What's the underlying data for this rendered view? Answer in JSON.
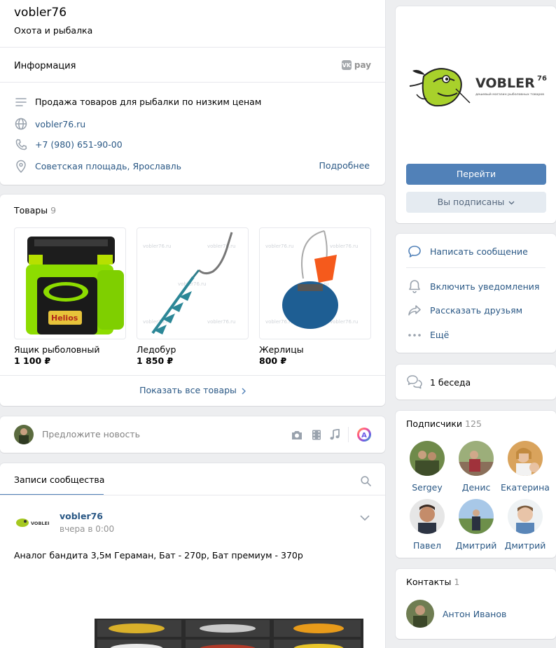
{
  "header": {
    "name": "vobler76",
    "status": "Охота и рыбалка"
  },
  "info": {
    "title": "Информация",
    "vkpay": "pay",
    "description": "Продажа товаров для рыбалки по низким ценам",
    "site": "vobler76.ru",
    "phone": "+7 (980) 651-90-00",
    "address": "Советская площадь, Ярославль",
    "more": "Подробнее"
  },
  "goods": {
    "title": "Товары",
    "count": "9",
    "watermark": "vobler76.ru",
    "items": [
      {
        "name": "Ящик рыболовный",
        "price": "1 100 ₽"
      },
      {
        "name": "Ледобур",
        "price": "1 850 ₽"
      },
      {
        "name": "Жерлицы",
        "price": "800 ₽"
      }
    ],
    "show_all": "Показать все товары"
  },
  "suggest": {
    "placeholder": "Предложите новость"
  },
  "wall": {
    "tab": "Записи сообщества",
    "post": {
      "author": "vobler76",
      "time": "вчера в 0:00",
      "text": "Аналог бандита 3,5м Гераман, Бат - 270р, Бат премиум - 370р"
    }
  },
  "cover": {
    "logo_text": "VOBLER",
    "logo_sup": "76",
    "logo_tagline": "дешевый магазин рыболовных товаров",
    "go_button": "Перейти",
    "subscribed_button": "Вы подписаны"
  },
  "actions": {
    "message": "Написать сообщение",
    "notify": "Включить уведомления",
    "share": "Рассказать друзьям",
    "more": "Ещё"
  },
  "chats": {
    "label": "1 беседа"
  },
  "subscribers": {
    "title": "Подписчики",
    "count": "125",
    "people": [
      "Sergey",
      "Денис",
      "Екатерина",
      "Павел",
      "Дмитрий",
      "Дмитрий"
    ]
  },
  "contacts": {
    "title": "Контакты",
    "count": "1",
    "person": "Антон Иванов"
  },
  "colors": {
    "accent": "#5181b8",
    "link": "#2a5885",
    "background": "#edeef0"
  }
}
